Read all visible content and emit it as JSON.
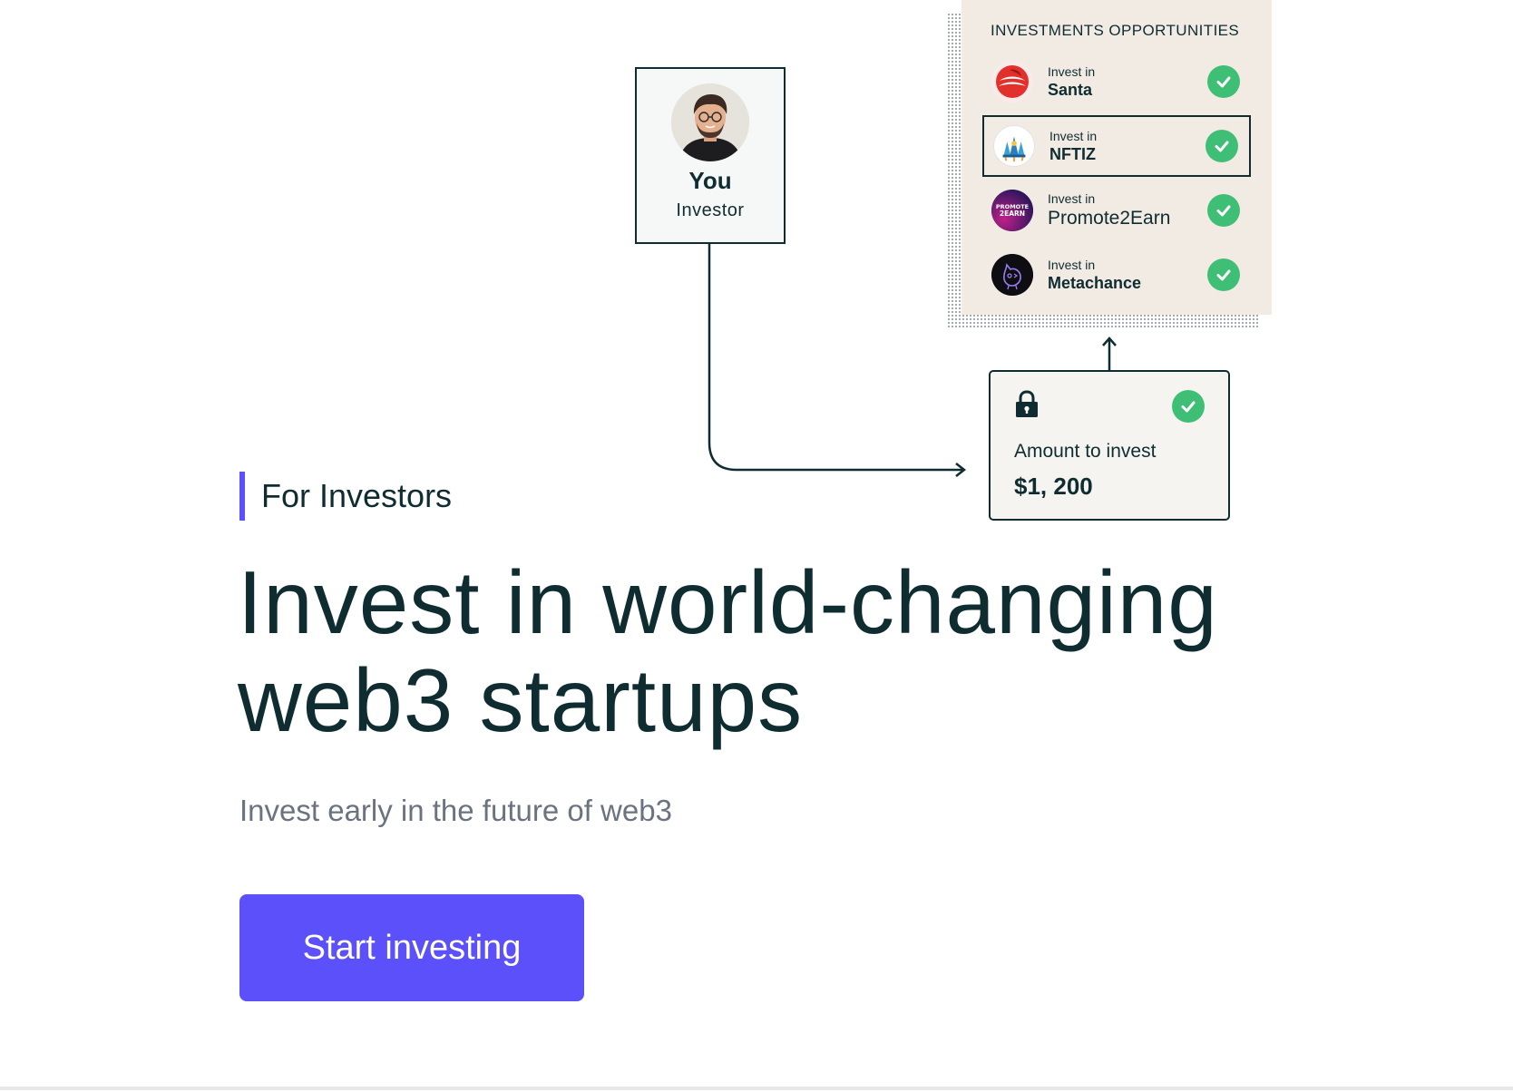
{
  "investor": {
    "name": "You",
    "role": "Investor"
  },
  "opportunities": {
    "title": "INVESTMENTS OPPORTUNITIES",
    "items": [
      {
        "prefix": "Invest in",
        "name": "Santa",
        "selected": false,
        "logo": "santa-logo-icon"
      },
      {
        "prefix": "Invest in",
        "name": "NFTIZ",
        "selected": true,
        "logo": "nftiz-logo-icon"
      },
      {
        "prefix": "Invest in",
        "name": "Promote2Earn",
        "selected": false,
        "logo": "promote2earn-logo-icon",
        "logo_text": "PROMOTE 2EARN"
      },
      {
        "prefix": "Invest in",
        "name": "Metachance",
        "selected": false,
        "logo": "metachance-logo-icon"
      }
    ]
  },
  "amount": {
    "label": "Amount to invest",
    "value": "$1, 200"
  },
  "hero": {
    "eyebrow": "For Investors",
    "headline_line1": "Invest in world-changing",
    "headline_line2": "web3 startups",
    "subtext": "Invest early in the future of web3",
    "cta_label": "Start investing"
  },
  "colors": {
    "accent": "#5b50f9",
    "ink": "#0f2d31",
    "check_green": "#3fbf76",
    "panel_beige": "#f1ebe4",
    "muted_text": "#6b7380"
  }
}
